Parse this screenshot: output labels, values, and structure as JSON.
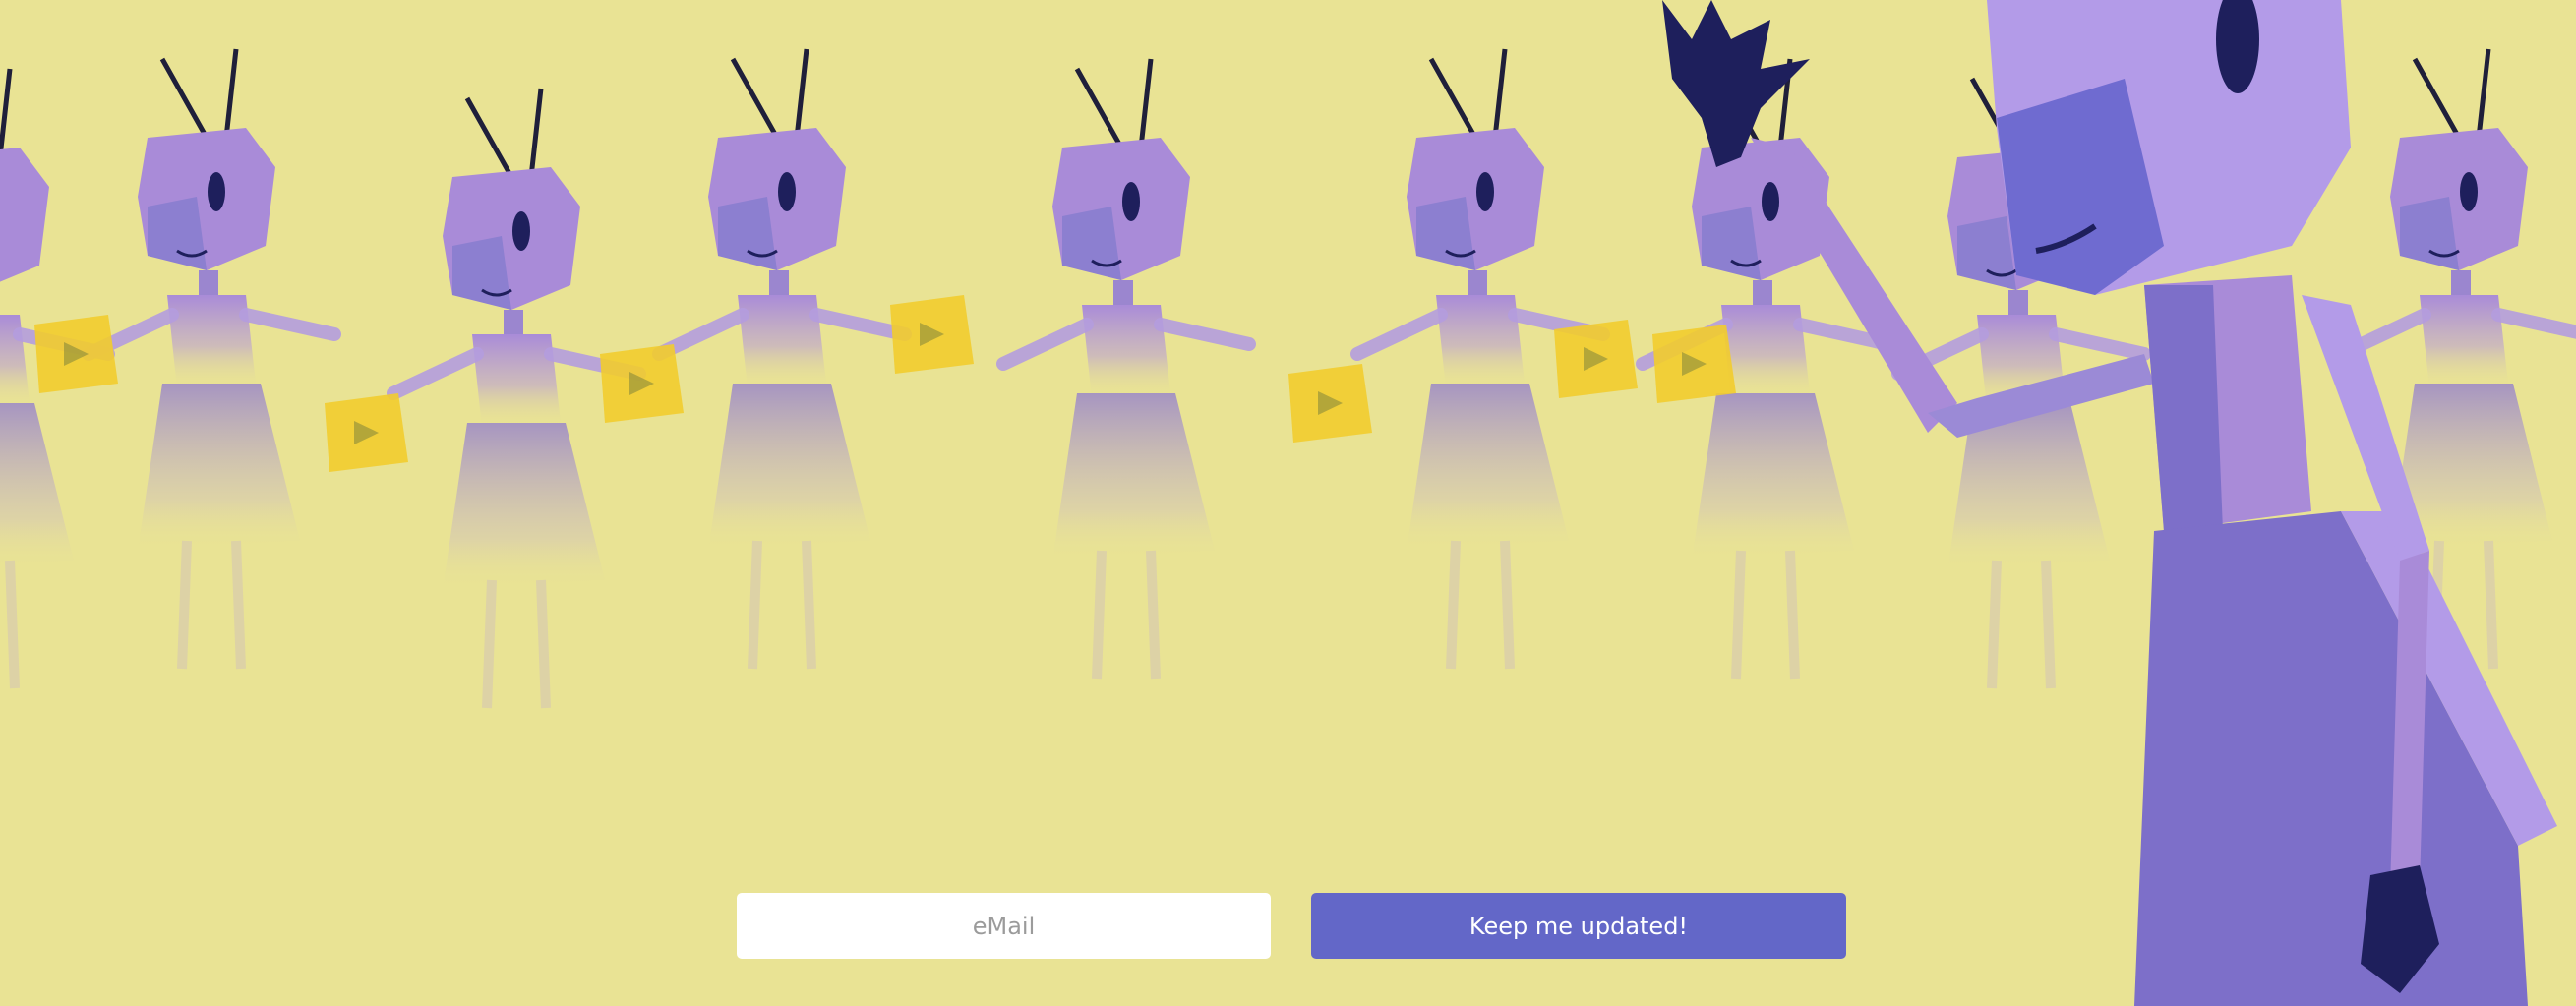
{
  "signup": {
    "email_placeholder": "eMail",
    "email_value": "",
    "submit_label": "Keep me updated!"
  },
  "illustration": {
    "description_name": "robot-ants-crowd",
    "colors": {
      "background": "#e9e394",
      "robot_body": "#a98bd8",
      "robot_shadow": "#7d6fc9",
      "robot_hand": "#1e1f5c",
      "card_yellow": "#f2cc2e",
      "button": "#6367c8"
    }
  }
}
